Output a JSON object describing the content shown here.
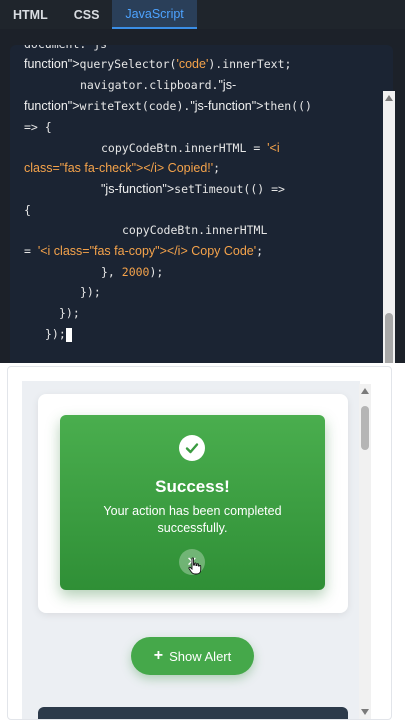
{
  "tabs": [
    {
      "label": "HTML",
      "active": false
    },
    {
      "label": "CSS",
      "active": false
    },
    {
      "label": "JavaScript",
      "active": true
    }
  ],
  "code_lines": [
    {
      "indent": 0,
      "segments": [
        {
          "t": "document. js",
          "c": "plain"
        }
      ]
    },
    {
      "indent": 0,
      "segments": [
        {
          "t": "function\">",
          "c": "str"
        },
        {
          "t": "querySelector(",
          "c": "plain"
        },
        {
          "t": "'code'",
          "c": "sq"
        },
        {
          "t": ").innerText;",
          "c": "plain"
        }
      ]
    },
    {
      "indent": 8,
      "segments": [
        {
          "t": "navigator.clipboard.",
          "c": "plain"
        },
        {
          "t": "\"js-",
          "c": "str"
        }
      ]
    },
    {
      "indent": 0,
      "segments": [
        {
          "t": "function\">",
          "c": "str"
        },
        {
          "t": "writeText(code).",
          "c": "plain"
        },
        {
          "t": "\"js-function\">",
          "c": "str"
        },
        {
          "t": "then(()",
          "c": "plain"
        }
      ]
    },
    {
      "indent": 0,
      "segments": [
        {
          "t": "=> {",
          "c": "plain"
        }
      ]
    },
    {
      "indent": 11,
      "segments": [
        {
          "t": "copyCodeBtn.innerHTML = ",
          "c": "plain"
        },
        {
          "t": "'<i",
          "c": "sq"
        }
      ]
    },
    {
      "indent": 0,
      "segments": [
        {
          "t": "class=\"fas fa-check\"></i> Copied!'",
          "c": "sq"
        },
        {
          "t": ";",
          "c": "plain"
        }
      ]
    },
    {
      "indent": 11,
      "segments": [
        {
          "t": "\"js-function\">",
          "c": "str"
        },
        {
          "t": "setTimeout(() =>",
          "c": "plain"
        }
      ]
    },
    {
      "indent": 0,
      "segments": [
        {
          "t": "{",
          "c": "plain"
        }
      ]
    },
    {
      "indent": 14,
      "segments": [
        {
          "t": "copyCodeBtn.innerHTML",
          "c": "plain"
        }
      ]
    },
    {
      "indent": 0,
      "segments": [
        {
          "t": "= ",
          "c": "plain"
        },
        {
          "t": "'<i class=\"fas fa-copy\"></i> Copy Code'",
          "c": "sq"
        },
        {
          "t": ";",
          "c": "plain"
        }
      ]
    },
    {
      "indent": 11,
      "segments": [
        {
          "t": "}, ",
          "c": "plain"
        },
        {
          "t": "2000",
          "c": "num"
        },
        {
          "t": ");",
          "c": "plain"
        }
      ]
    },
    {
      "indent": 8,
      "segments": [
        {
          "t": "});",
          "c": "plain"
        }
      ]
    },
    {
      "indent": 5,
      "segments": [
        {
          "t": "});",
          "c": "plain"
        }
      ]
    },
    {
      "indent": 3,
      "segments": [
        {
          "t": "});",
          "c": "plain"
        }
      ]
    }
  ],
  "alert": {
    "title": "Success!",
    "message": "Your action has been completed successfully.",
    "close_glyph": "✕"
  },
  "show_button": {
    "plus": "+",
    "label": "Show Alert"
  },
  "colors": {
    "accent_tab": "#4da3ff",
    "success": "#45a84a",
    "orange": "#f5a34b"
  }
}
